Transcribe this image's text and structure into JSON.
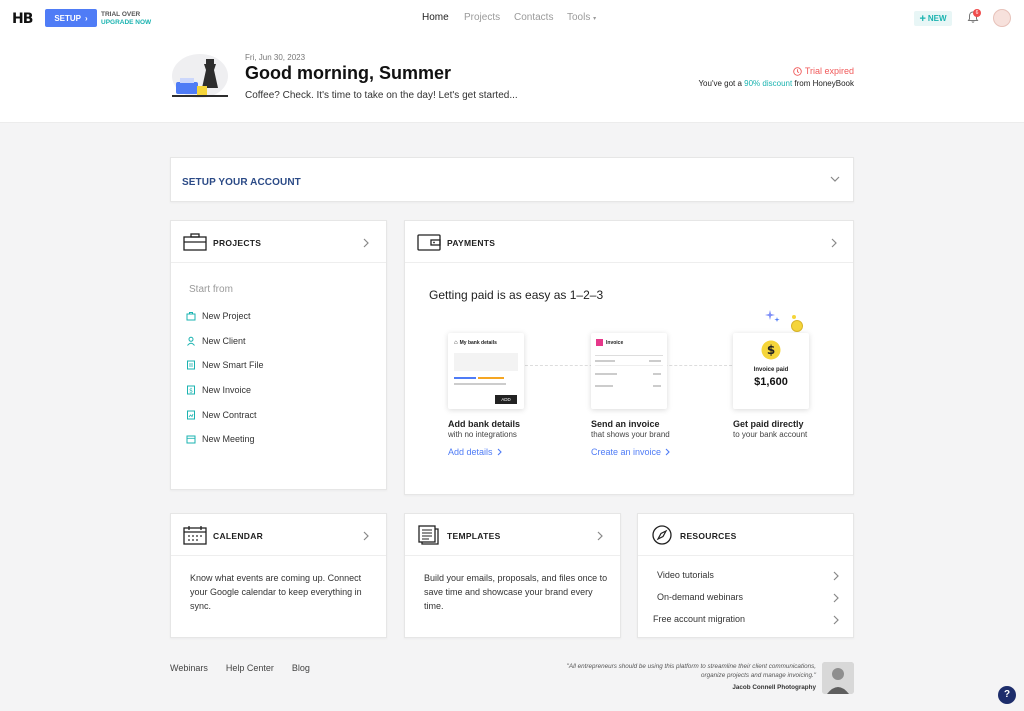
{
  "nav": {
    "logo": "HB",
    "setup_label": "SETUP",
    "trial_over": "TRIAL OVER",
    "upgrade_now": "UPGRADE NOW",
    "links": [
      "Home",
      "Projects",
      "Contacts",
      "Tools"
    ],
    "active_link": "Home",
    "new_label": "NEW",
    "notification_count": "6",
    "colors": {
      "accent": "#4f7cf6",
      "teal": "#1ab3b0",
      "alert": "#f05a5a"
    }
  },
  "hero": {
    "date": "Fri, Jun 30, 2023",
    "greeting": "Good morning, Summer",
    "subtitle": "Coffee? Check. It's time to take on the day! Let's get started...",
    "trial_expired": "Trial expired",
    "discount_prefix": "You've got a ",
    "discount_pct": "90% discount",
    "discount_suffix": " from HoneyBook"
  },
  "setup_account": {
    "title": "SETUP YOUR ACCOUNT"
  },
  "projects": {
    "title": "PROJECTS",
    "start_from": "Start from",
    "items": [
      {
        "label": "New Project",
        "icon": "project-icon"
      },
      {
        "label": "New Client",
        "icon": "client-icon"
      },
      {
        "label": "New Smart File",
        "icon": "smart-file-icon"
      },
      {
        "label": "New Invoice",
        "icon": "invoice-icon"
      },
      {
        "label": "New Contract",
        "icon": "contract-icon"
      },
      {
        "label": "New Meeting",
        "icon": "meeting-icon"
      }
    ]
  },
  "payments": {
    "title": "PAYMENTS",
    "headline": "Getting paid is as easy as 1–2–3",
    "steps": [
      {
        "title": "Add bank details",
        "sub": "with no integrations",
        "link": "Add details",
        "card_title": "My bank details",
        "card_button": "ADD"
      },
      {
        "title": "Send an invoice",
        "sub": "that shows your brand",
        "link": "Create an invoice",
        "card_title": "Invoice"
      },
      {
        "title": "Get paid directly",
        "sub": "to your bank account",
        "link": "",
        "card_title": "Invoice paid",
        "card_amount": "$1,600"
      }
    ]
  },
  "calendar": {
    "title": "CALENDAR",
    "body": "Know what events are coming up. Connect your Google calendar to keep everything in sync."
  },
  "templates": {
    "title": "TEMPLATES",
    "body": "Build your emails, proposals, and files once to save time and showcase your brand every time."
  },
  "resources": {
    "title": "RESOURCES",
    "items": [
      "Video tutorials",
      "On-demand webinars",
      "Free account migration"
    ]
  },
  "footer": {
    "links": [
      "Webinars",
      "Help Center",
      "Blog"
    ],
    "quote": "\"All entrepreneurs should be using this platform to streamline their client communications, organize projects and manage invoicing.\"",
    "author": "Jacob Connell Photography",
    "help": "?"
  }
}
